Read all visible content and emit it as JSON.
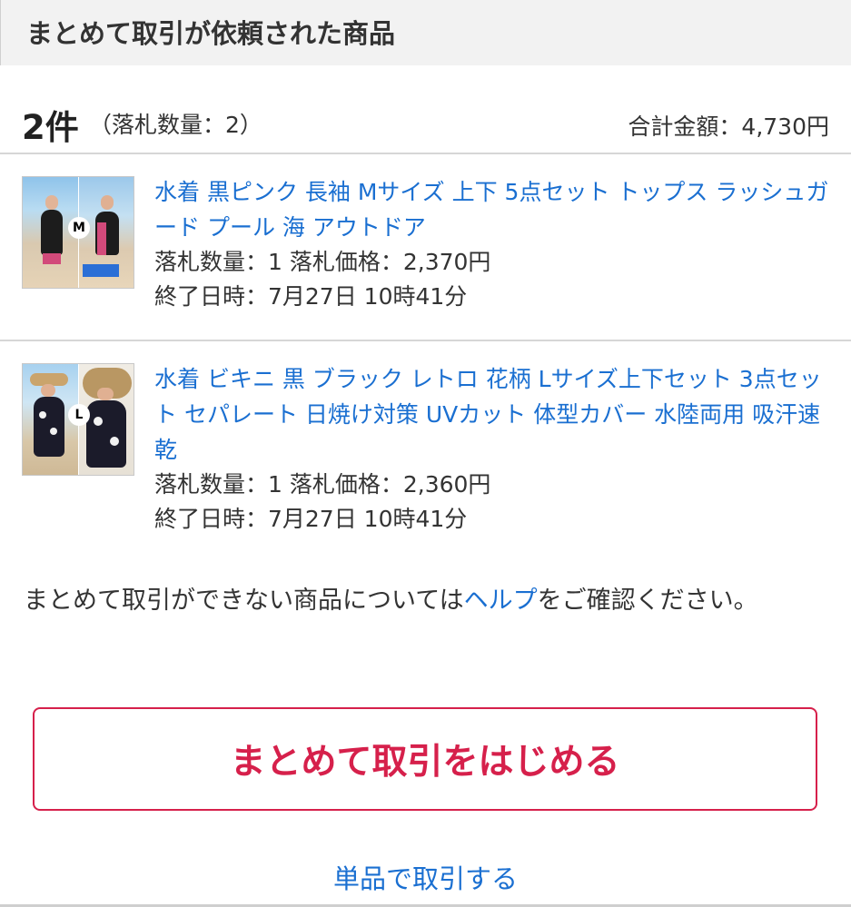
{
  "header": {
    "title": "まとめて取引が依頼された商品"
  },
  "summary": {
    "count": "2件",
    "bid_quantity": "（落札数量：2）",
    "total": "合計金額：4,730円"
  },
  "items": [
    {
      "size_badge": "M",
      "title": "水着 黒ピンク 長袖 Mサイズ 上下 5点セット トップス ラッシュガード プール 海 アウトドア",
      "bid_line": "落札数量：1 落札価格：2,370円",
      "end_line": "終了日時：7月27日 10時41分"
    },
    {
      "size_badge": "L",
      "title": "水着 ビキニ 黒 ブラック レトロ 花柄 Lサイズ上下セット 3点セット セパレート 日焼け対策 UVカット 体型カバー 水陸両用 吸汗速乾",
      "bid_line": "落札数量：1 落札価格：2,360円",
      "end_line": "終了日時：7月27日 10時41分"
    }
  ],
  "note": {
    "prefix": "まとめて取引ができない商品については",
    "link": "ヘルプ",
    "suffix": "をご確認ください。"
  },
  "actions": {
    "primary_label": "まとめて取引をはじめる",
    "secondary_label": "単品で取引する"
  },
  "colors": {
    "link": "#1a6fd1",
    "primary": "#d6204b",
    "header_bg": "#f2f2f2"
  }
}
